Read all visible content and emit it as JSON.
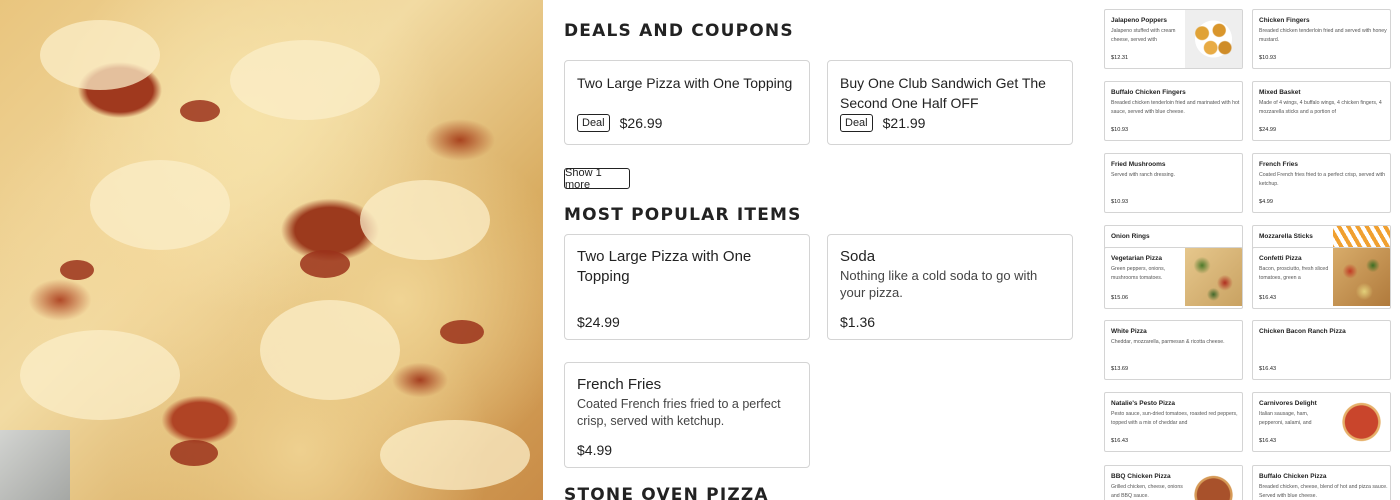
{
  "deals": {
    "section_title": "Deals and Coupons",
    "items": [
      {
        "name": "Two Large Pizza with One Topping",
        "badge": "Deal",
        "price": "$26.99"
      },
      {
        "name": "Buy One Club Sandwich Get The Second One Half OFF",
        "badge": "Deal",
        "price": "$21.99"
      }
    ],
    "show_more_label": "Show 1 more"
  },
  "popular": {
    "section_title": "Most Popular Items",
    "items": [
      {
        "name": "Two Large Pizza with One Topping",
        "desc": "",
        "price": "$24.99"
      },
      {
        "name": "Soda",
        "desc": "Nothing like a cold soda to go with your pizza.",
        "price": "$1.36"
      },
      {
        "name": "French Fries",
        "desc": "Coated French fries fried to a perfect crisp, served with ketchup.",
        "price": "$4.99"
      }
    ]
  },
  "stone_oven": {
    "section_title": "Stone Oven Pizza"
  },
  "menu_grid": [
    {
      "name": "Jalapeno Poppers",
      "desc": "Jalapeno stuffed with cream cheese, served with",
      "price": "$12.31",
      "thumb": "poppers"
    },
    {
      "name": "Chicken Fingers",
      "desc": "Breaded chicken tenderloin fried and served with honey mustard.",
      "price": "$10.93"
    },
    {
      "name": "Buffalo Chicken Fingers",
      "desc": "Breaded chicken tenderloin fried and marinated with hot sauce, served with blue cheese.",
      "price": "$10.93"
    },
    {
      "name": "Mixed Basket",
      "desc": "Made of 4 wings, 4 buffalo wings, 4 chicken fingers, 4 mozzarella sticks and a portion of",
      "price": "$24.99"
    },
    {
      "name": "Fried Mushrooms",
      "desc": "Served with ranch dressing.",
      "price": "$10.93"
    },
    {
      "name": "French Fries",
      "desc": "Coated French fries fried to a perfect crisp, served with ketchup.",
      "price": "$4.99"
    },
    {
      "name": "Onion Rings",
      "desc": "",
      "price": ""
    },
    {
      "name": "Mozzarella Sticks",
      "desc": "",
      "price": "",
      "thumb": "sticks"
    },
    {
      "name": "Vegetarian Pizza",
      "desc": "Green peppers, onions, mushrooms tomatoes.",
      "price": "$15.06",
      "thumb": "veg"
    },
    {
      "name": "Confetti Pizza",
      "desc": "Bacon, prosciutto, fresh sliced tomatoes, green a",
      "price": "$16.43",
      "thumb": "confetti"
    },
    {
      "name": "White Pizza",
      "desc": "Cheddar, mozzarella, parmesan & ricotta cheese.",
      "price": "$13.69"
    },
    {
      "name": "Chicken Bacon Ranch Pizza",
      "desc": "",
      "price": "$16.43"
    },
    {
      "name": "Natalie's Pesto Pizza",
      "desc": "Pesto sauce, sun-dried tomatoes, roasted red peppers, topped with a mix of cheddar and",
      "price": "$16.43"
    },
    {
      "name": "Carnivores Delight",
      "desc": "Italian sausage, ham, pepperoni, salami, and",
      "price": "$16.43",
      "thumb": "carn"
    },
    {
      "name": "BBQ Chicken Pizza",
      "desc": "Grilled chicken, cheese, onions and BBQ sauce.",
      "price": "",
      "thumb": "bbq"
    },
    {
      "name": "Buffalo Chicken Pizza",
      "desc": "Breaded chicken, cheese, blend of hot and pizza sauce. Served with blue cheese.",
      "price": ""
    }
  ]
}
